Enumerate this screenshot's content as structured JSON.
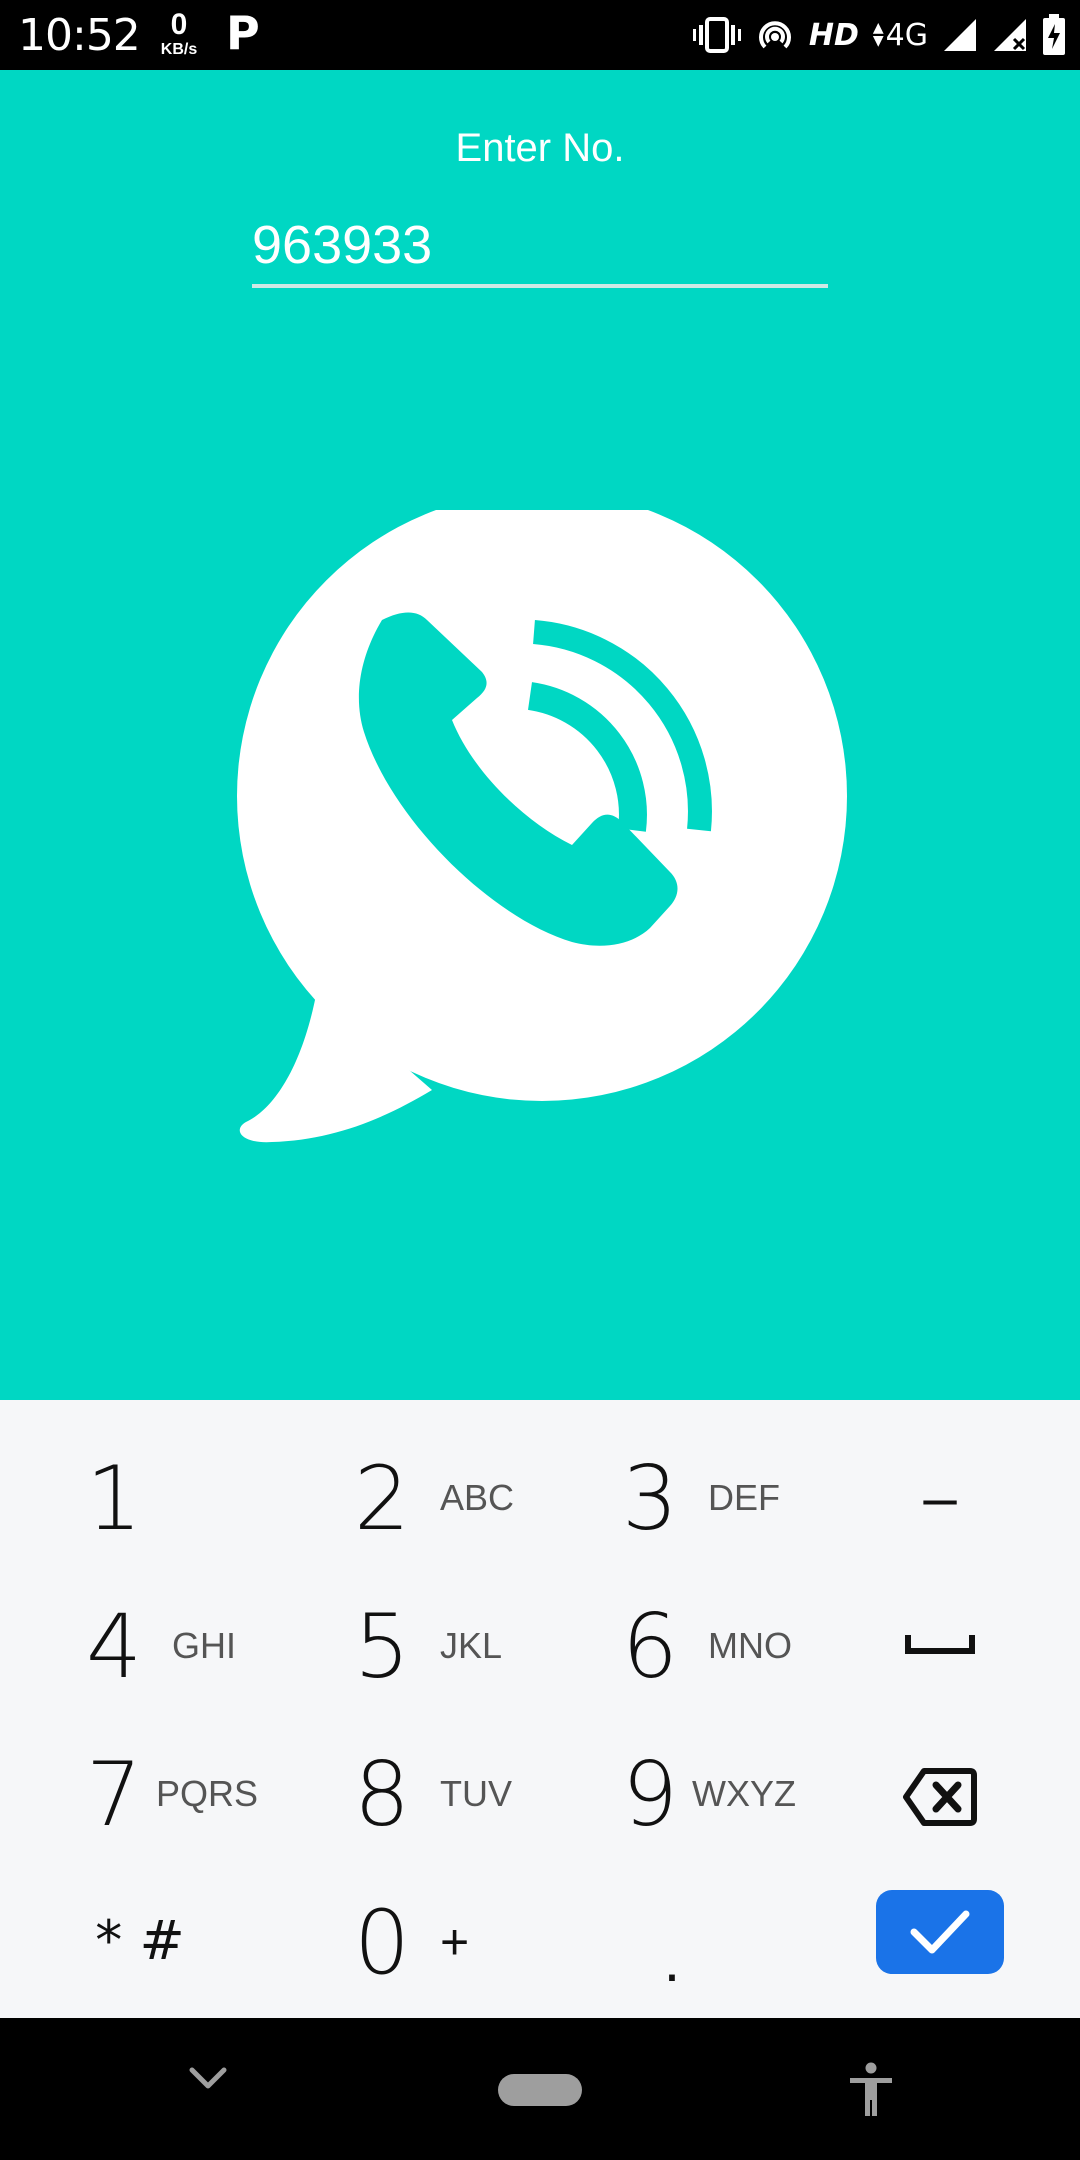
{
  "status_bar": {
    "time": "10:52",
    "speed_value": "0",
    "speed_unit": "KB/s",
    "app_badge": "P",
    "hd": "HD",
    "network": "4G"
  },
  "main": {
    "label": "Enter No.",
    "number_value": "963933",
    "background_color": "#00d7c3",
    "logo_icon": "call-bubble-icon"
  },
  "keypad": {
    "keys": [
      {
        "digit": "1",
        "letters": ""
      },
      {
        "digit": "2",
        "letters": "ABC"
      },
      {
        "digit": "3",
        "letters": "DEF"
      },
      {
        "digit": "4",
        "letters": "GHI"
      },
      {
        "digit": "5",
        "letters": "JKL"
      },
      {
        "digit": "6",
        "letters": "MNO"
      },
      {
        "digit": "7",
        "letters": "PQRS"
      },
      {
        "digit": "8",
        "letters": "TUV"
      },
      {
        "digit": "9",
        "letters": "WXYZ"
      },
      {
        "digit": "0",
        "letters": "+"
      }
    ],
    "star_hash": "* #",
    "dash": "–",
    "dot": ".",
    "space_icon": "space-icon",
    "backspace_icon": "backspace-icon",
    "done_icon": "checkmark-icon",
    "done_color": "#1a73e8"
  },
  "nav_bar": {
    "back_icon": "chevron-down-icon",
    "home_icon": "home-pill-icon",
    "accessibility_icon": "accessibility-icon"
  }
}
